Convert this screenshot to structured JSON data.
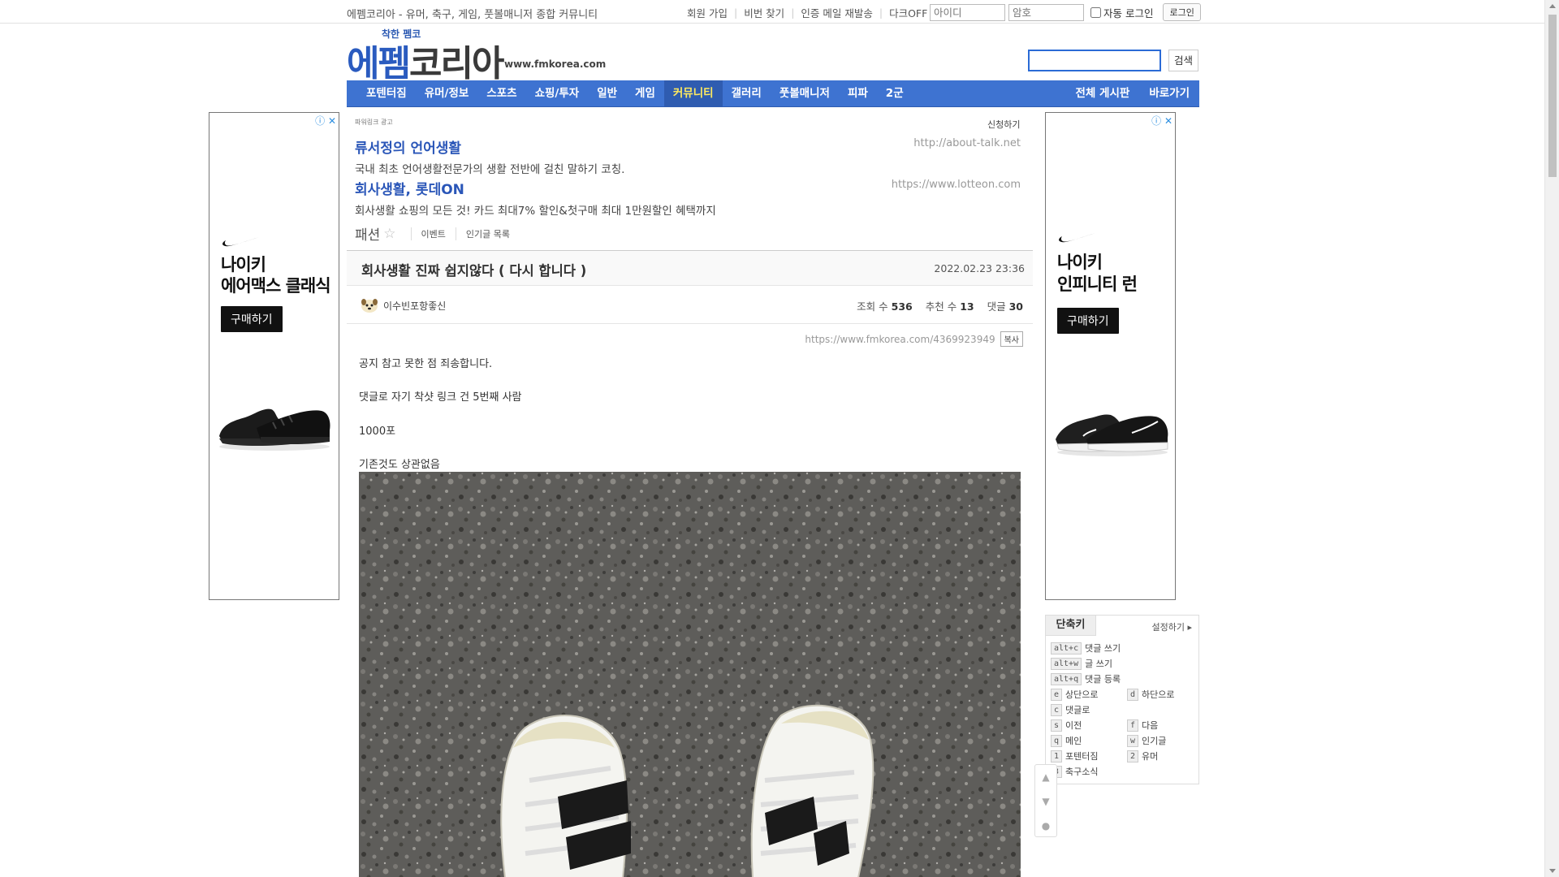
{
  "topbar": {
    "tagline": "에펨코리아 - 유머, 축구, 게임, 풋볼매니저 종합 커뮤니티",
    "links": [
      "회원 가입",
      "비번 찾기",
      "인증 메일 재발송",
      "다크OFF"
    ],
    "id_placeholder": "아이디",
    "pw_placeholder": "암호",
    "auto_login": "자동 로그인",
    "login_button": "로그인"
  },
  "header": {
    "logo_sub": "착한 펨코",
    "logo_main_a": "에펨",
    "logo_main_b": "코리아",
    "logo_url": "www.fmkorea.com",
    "search_button": "검색"
  },
  "nav": {
    "items": [
      "포텐터짐",
      "유머/정보",
      "스포츠",
      "쇼핑/투자",
      "일반",
      "게임",
      "커뮤니티",
      "갤러리",
      "풋볼매니저",
      "피파",
      "2군"
    ],
    "active_index": 6,
    "right_items": [
      "전체 게시판",
      "바로가기"
    ]
  },
  "ad_left": {
    "title_line1": "나이키",
    "title_line2": "에어맥스 클래식",
    "buy": "구매하기"
  },
  "ad_right": {
    "title_line1": "나이키",
    "title_line2": "인피니티 런",
    "buy": "구매하기"
  },
  "powerlink": {
    "label": "파워링크 광고",
    "apply": "신청하기",
    "ads": [
      {
        "title": "류서정의 언어생활",
        "desc": "국내 최초 언어생활전문가의 생활 전반에 걸친 말하기 코칭.",
        "url": "http://about-talk.net"
      },
      {
        "title": "회사생활, 롯데ON",
        "desc": "회사생활 쇼핑의 모든 것! 카드 최대7% 할인&첫구매 최대 1만원할인 혜택까지",
        "url": "https://www.lotteon.com"
      }
    ]
  },
  "board": {
    "name": "패션",
    "star": "☆",
    "sub1": "이벤트",
    "sub2": "인기글 목록"
  },
  "post": {
    "title": "회사생활 진짜 쉽지않다 ( 다시 합니다 )",
    "date": "2022.02.23 23:36",
    "author": "이수빈포항좋신",
    "views_label": "조회 수",
    "views": "536",
    "votes_label": "추천 수",
    "votes": "13",
    "comments_label": "댓글",
    "comments": "30",
    "url": "https://www.fmkorea.com/4369923949",
    "copy": "복사",
    "lines": [
      "공지 참고 못한 점 죄송합니다.",
      "댓글로 자기 착샷 링크 건 5번째 사람",
      "1000포",
      "기존것도 상관없음"
    ]
  },
  "shortcuts": {
    "tab": "단축키",
    "setting": "설정하기",
    "items": [
      {
        "key": "alt+c",
        "label": "댓글 쓰기"
      },
      {
        "key": "alt+w",
        "label": "글 쓰기"
      },
      {
        "key": "alt+q",
        "label": "댓글 등록"
      },
      {
        "key": "e",
        "label": "상단으로"
      },
      {
        "key": "d",
        "label": "하단으로"
      },
      {
        "key": "c",
        "label": "댓글로"
      },
      {
        "key": "s",
        "label": "이전"
      },
      {
        "key": "f",
        "label": "다음"
      },
      {
        "key": "q",
        "label": "메인"
      },
      {
        "key": "w",
        "label": "인기글"
      },
      {
        "key": "1",
        "label": "포텐터짐"
      },
      {
        "key": "2",
        "label": "유머"
      },
      {
        "key": "3",
        "label": "축구소식"
      }
    ]
  },
  "colors": {
    "nav_bg": "#3e73d1",
    "nav_active": "#2f5cb0",
    "nav_active_text": "#ffea5f",
    "link_blue": "#2a56b8"
  }
}
